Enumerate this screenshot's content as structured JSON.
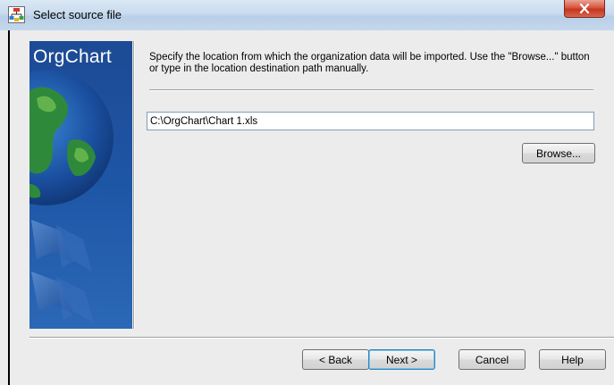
{
  "window": {
    "title": "Select source file",
    "icon": "orgchart-app-icon",
    "close_icon": "close-icon"
  },
  "banner": {
    "title": "OrgChart"
  },
  "main": {
    "description": "Specify the location from which the organization data will be imported. Use the \"Browse...\" button or type in the location destination path manually.",
    "path_value": "C:\\OrgChart\\Chart 1.xls",
    "browse_label": "Browse..."
  },
  "footer": {
    "back_label": "< Back",
    "next_label": "Next >",
    "cancel_label": "Cancel",
    "help_label": "Help"
  },
  "colors": {
    "banner_blue": "#1e56a6",
    "close_red": "#c2361f",
    "dialog_bg": "#ececec"
  }
}
